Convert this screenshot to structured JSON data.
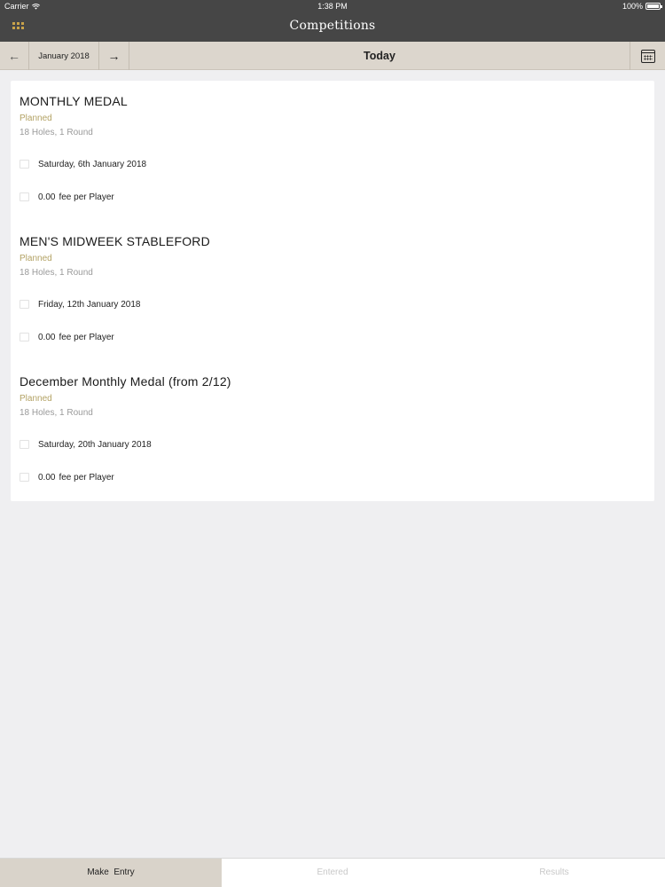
{
  "status_bar": {
    "carrier": "Carrier",
    "time": "1:38 PM",
    "battery": "100%"
  },
  "nav": {
    "title": "Competitions",
    "menu_icon": "grid-menu-icon"
  },
  "toolbar": {
    "prev_icon": "←",
    "month": "January 2018",
    "next_icon": "→",
    "today": "Today",
    "calendar_icon": "calendar-icon"
  },
  "competitions": [
    {
      "name": "MONTHLY MEDAL",
      "status": "Planned",
      "holes": "18 Holes, 1 Round",
      "date": "Saturday, 6th January 2018",
      "fee": "0.00",
      "fee_label": "fee per Player"
    },
    {
      "name": "MEN'S MIDWEEK STABLEFORD",
      "status": "Planned",
      "holes": "18 Holes, 1 Round",
      "date": "Friday, 12th January 2018",
      "fee": "0.00",
      "fee_label": "fee per Player"
    },
    {
      "name": "December Monthly Medal (from 2/12)",
      "status": "Planned",
      "holes": "18 Holes, 1 Round",
      "date": "Saturday, 20th January 2018",
      "fee": "0.00",
      "fee_label": "fee per Player"
    }
  ],
  "tabs": [
    {
      "label": "Make  Entry",
      "active": true
    },
    {
      "label": "Entered",
      "active": false
    },
    {
      "label": "Results",
      "active": false
    }
  ],
  "colors": {
    "nav_bg": "#464646",
    "toolbar_bg": "#dcd6cd",
    "status_planned": "#b3a264",
    "menu_icon": "#c9a34a"
  }
}
